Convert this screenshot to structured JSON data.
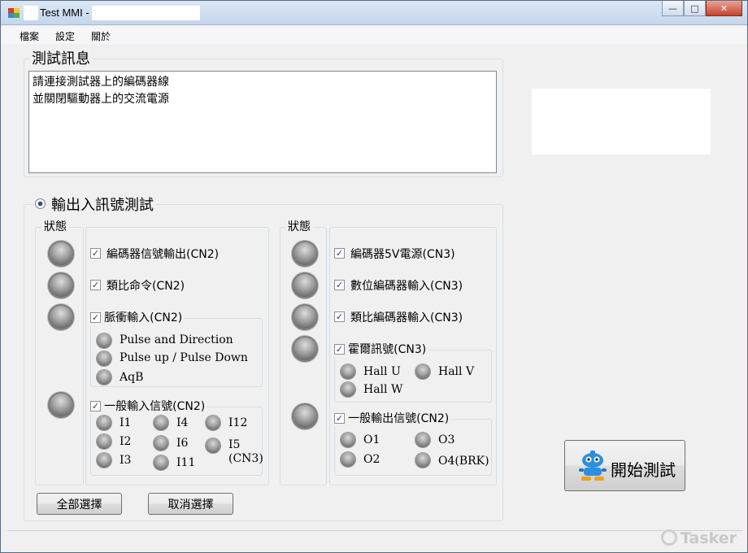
{
  "window": {
    "title": "Test MMI -",
    "caption": {
      "minimize": "—",
      "maximize": "□",
      "close": "✕"
    }
  },
  "menu": [
    "檔案",
    "設定",
    "關於"
  ],
  "message_group": {
    "title": "測試訊息",
    "text": "請連接測試器上的編碼器線\n並關閉驅動器上的交流電源"
  },
  "io_group": {
    "title": "輸出入訊號測試",
    "left": {
      "status_label": "狀態",
      "items": [
        {
          "label": "編碼器信號輸出(CN2)",
          "checked": true
        },
        {
          "label": "類比命令(CN2)",
          "checked": true
        },
        {
          "label": "脈衝輸入(CN2)",
          "checked": true
        },
        {
          "label": "一般輸入信號(CN2)",
          "checked": true
        }
      ],
      "pulse_modes": [
        "Pulse and  Direction",
        "Pulse up / Pulse Down",
        "AqB"
      ],
      "inputs": [
        "I1",
        "I4",
        "I12",
        "I2",
        "I6",
        "I5",
        "(CN3)",
        "I3",
        "I11"
      ]
    },
    "right": {
      "status_label": "狀態",
      "items": [
        {
          "label": "編碼器5V電源(CN3)",
          "checked": true
        },
        {
          "label": "數位編碼器輸入(CN3)",
          "checked": true
        },
        {
          "label": "類比編碼器輸入(CN3)",
          "checked": true
        },
        {
          "label": "霍爾訊號(CN3)",
          "checked": true
        },
        {
          "label": "一般輸出信號(CN2)",
          "checked": true
        }
      ],
      "hall": [
        "Hall U",
        "Hall V",
        "Hall W"
      ],
      "outputs": [
        "O1",
        "O3",
        "O2",
        "O4(BRK)"
      ]
    },
    "buttons": {
      "select_all": "全部選擇",
      "deselect": "取消選擇"
    }
  },
  "start_button": {
    "label": "開始測試",
    "icon": "robot-icon"
  },
  "watermark": "Tasker",
  "check_mark": "✓"
}
